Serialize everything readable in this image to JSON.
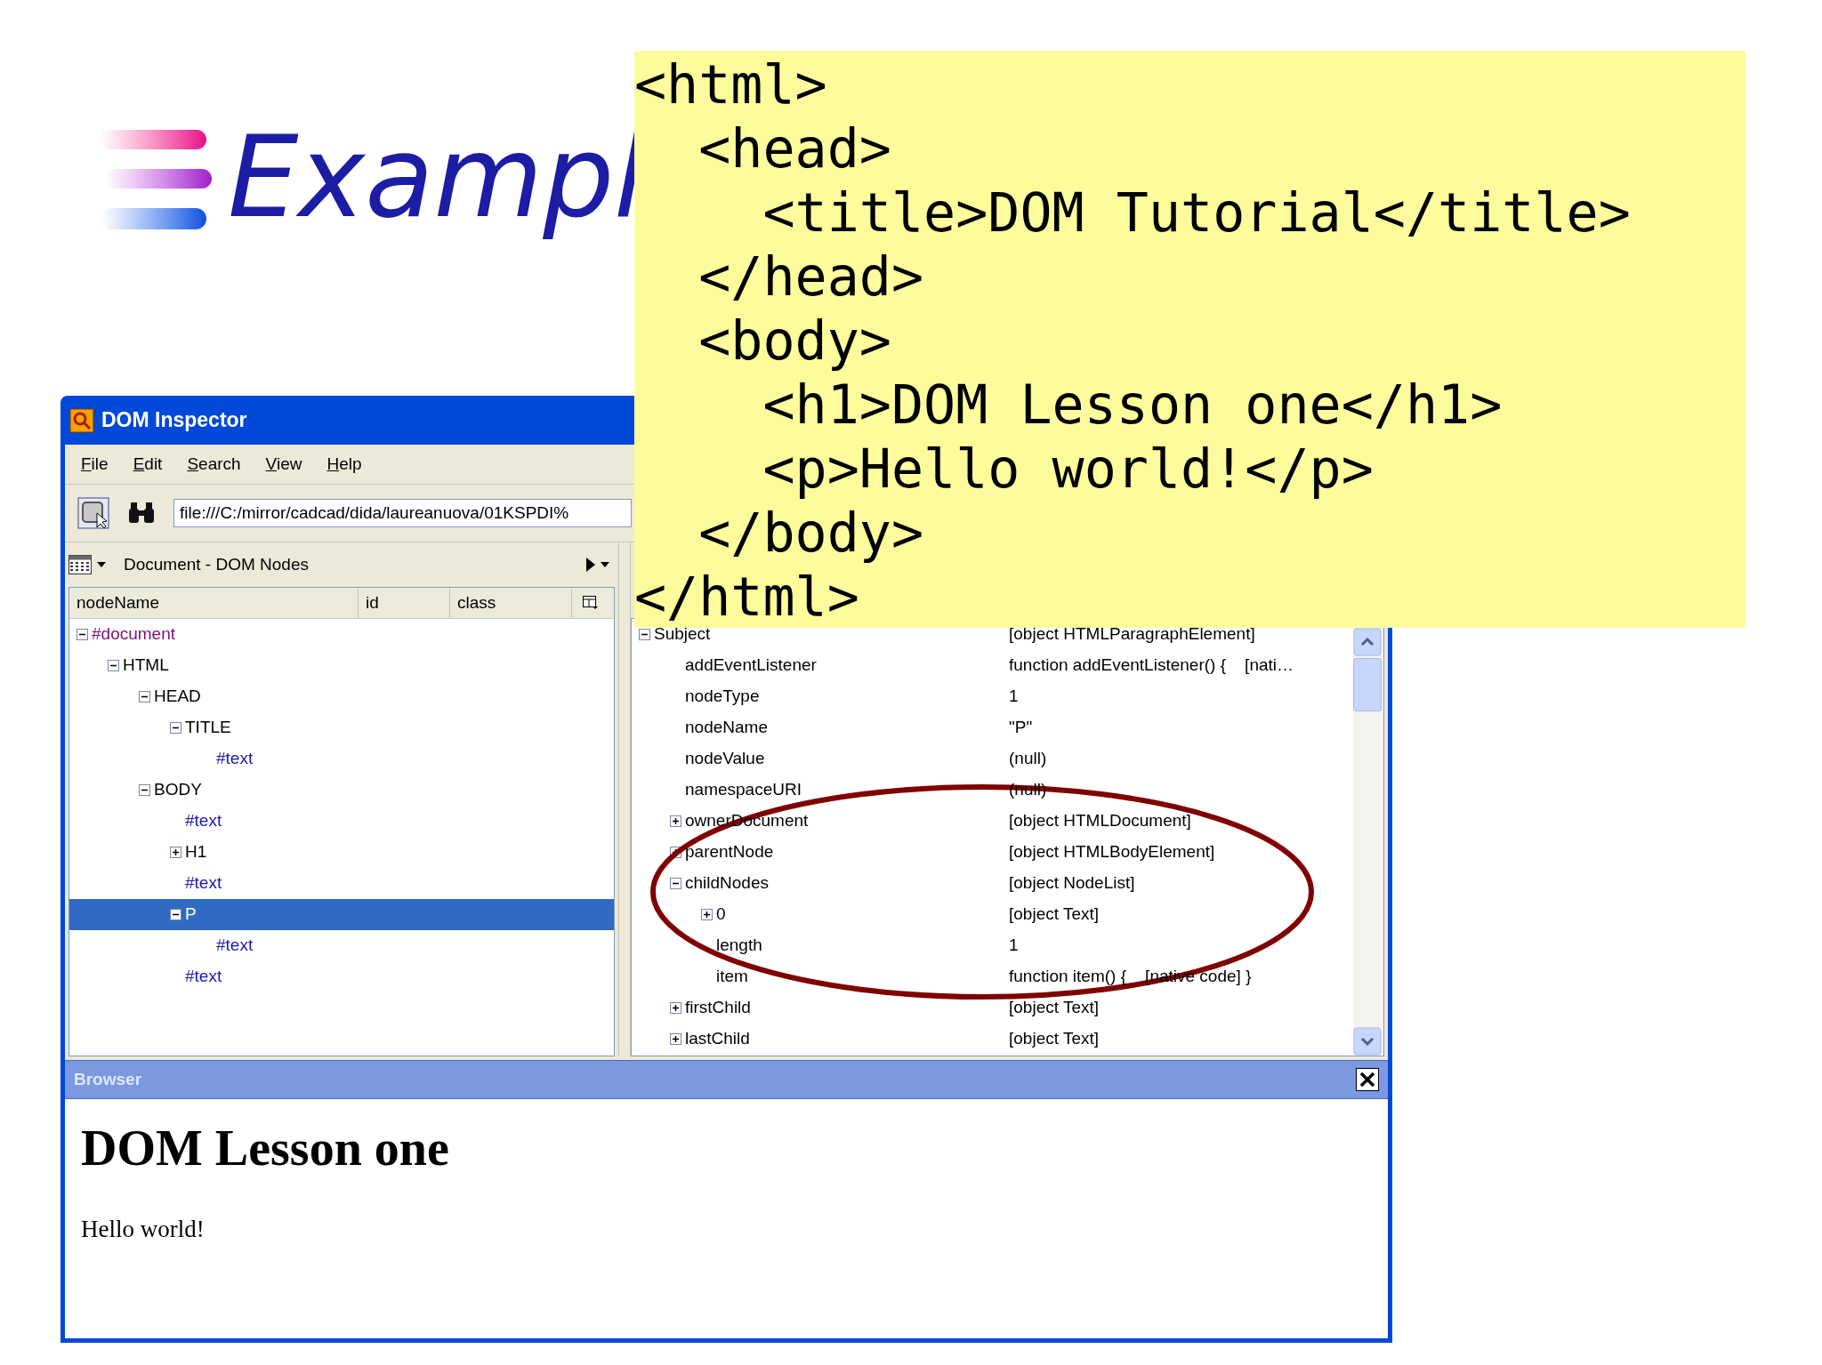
{
  "slide": {
    "title": "Exampl"
  },
  "code_box": {
    "lines": [
      "<html>",
      "  <head>",
      "    <title>DOM Tutorial</title>",
      "  </head>",
      "  <body>",
      "    <h1>DOM Lesson one</h1>",
      "    <p>Hello world!</p>",
      "  </body>",
      "</html>"
    ]
  },
  "window": {
    "title": "DOM Inspector",
    "menu": [
      "File",
      "Edit",
      "Search",
      "View",
      "Help"
    ],
    "address": "file:///C:/mirror/cadcad/dida/laureanuova/01KSPDI%"
  },
  "left_panel": {
    "title": "Document - DOM Nodes",
    "columns": [
      "nodeName",
      "id",
      "class"
    ],
    "tree": [
      {
        "label": "#document",
        "kind": "document",
        "expanded": true,
        "selected": false,
        "children": [
          {
            "label": "HTML",
            "kind": "element",
            "expanded": true,
            "selected": false,
            "children": [
              {
                "label": "HEAD",
                "kind": "element",
                "expanded": true,
                "selected": false,
                "children": [
                  {
                    "label": "TITLE",
                    "kind": "element",
                    "expanded": true,
                    "selected": false,
                    "children": [
                      {
                        "label": "#text",
                        "kind": "text",
                        "selected": false
                      }
                    ]
                  }
                ]
              },
              {
                "label": "BODY",
                "kind": "element",
                "expanded": true,
                "selected": false,
                "children": [
                  {
                    "label": "#text",
                    "kind": "text",
                    "selected": false
                  },
                  {
                    "label": "H1",
                    "kind": "element",
                    "expanded": false,
                    "selected": false
                  },
                  {
                    "label": "#text",
                    "kind": "text",
                    "selected": false
                  },
                  {
                    "label": "P",
                    "kind": "element",
                    "expanded": true,
                    "selected": true,
                    "children": [
                      {
                        "label": "#text",
                        "kind": "text",
                        "selected": false
                      }
                    ]
                  },
                  {
                    "label": "#text",
                    "kind": "text",
                    "selected": false
                  }
                ]
              }
            ]
          }
        ]
      }
    ]
  },
  "right_panel": {
    "rows": [
      {
        "name": "Subject",
        "value": "[object HTMLParagraphElement]",
        "expanded": true,
        "children": [
          {
            "name": "addEventListener",
            "value": "function addEventListener() {    [nati…"
          },
          {
            "name": "nodeType",
            "value": "1"
          },
          {
            "name": "nodeName",
            "value": "\"P\""
          },
          {
            "name": "nodeValue",
            "value": "(null)"
          },
          {
            "name": "namespaceURI",
            "value": "(null)"
          },
          {
            "name": "ownerDocument",
            "value": "[object HTMLDocument]",
            "expanded": false
          },
          {
            "name": "parentNode",
            "value": "[object HTMLBodyElement]",
            "expanded": false
          },
          {
            "name": "childNodes",
            "value": "[object NodeList]",
            "expanded": true,
            "children": [
              {
                "name": "0",
                "value": "[object Text]",
                "expanded": false
              },
              {
                "name": "length",
                "value": "1"
              },
              {
                "name": "item",
                "value": "function item() {    [native code] }"
              }
            ]
          },
          {
            "name": "firstChild",
            "value": "[object Text]",
            "expanded": false
          },
          {
            "name": "lastChild",
            "value": "[object Text]",
            "expanded": false
          }
        ]
      }
    ]
  },
  "browser": {
    "title": "Browser",
    "heading": "DOM Lesson one",
    "paragraph": "Hello world!"
  }
}
